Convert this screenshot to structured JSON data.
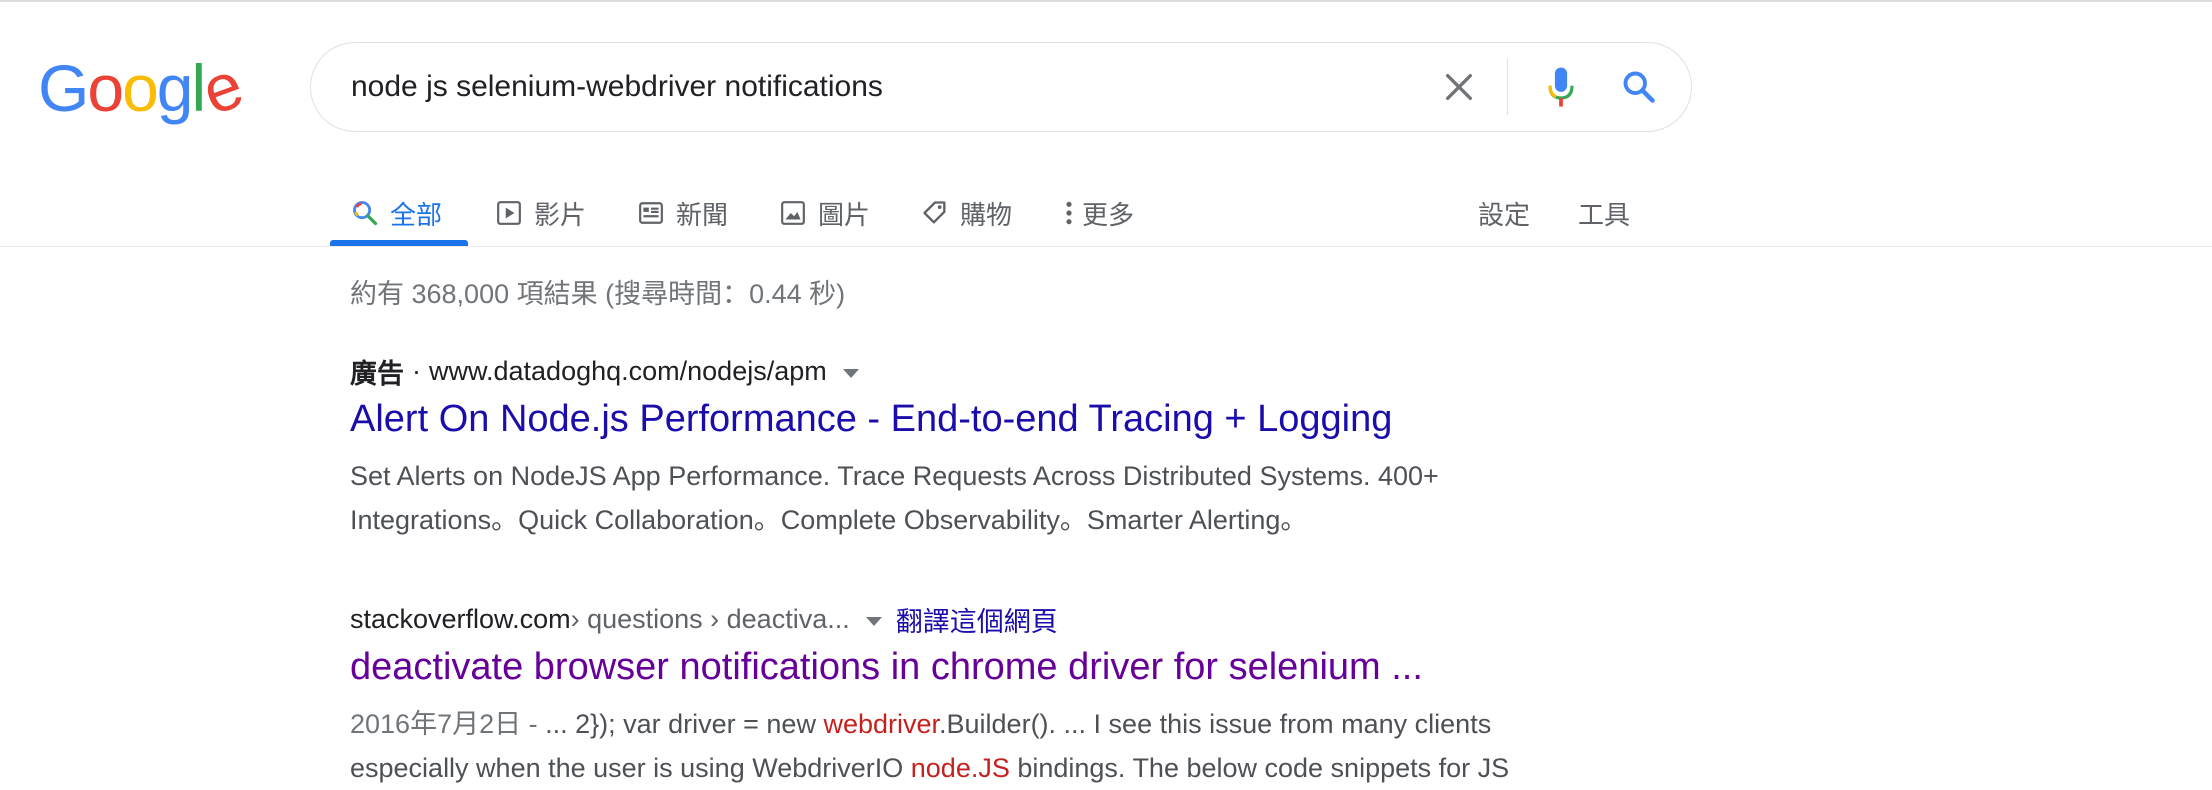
{
  "logo": {
    "letters": [
      "G",
      "o",
      "o",
      "g",
      "l",
      "e"
    ],
    "colors": [
      "#4285F4",
      "#EA4335",
      "#FBBC05",
      "#4285F4",
      "#34A853",
      "#EA4335"
    ]
  },
  "search": {
    "query": "node js selenium-webdriver notifications"
  },
  "tabs": [
    {
      "label": "全部",
      "icon": "search-icon",
      "active": true
    },
    {
      "label": "影片",
      "icon": "play-icon"
    },
    {
      "label": "新聞",
      "icon": "news-icon"
    },
    {
      "label": "圖片",
      "icon": "image-icon"
    },
    {
      "label": "購物",
      "icon": "tag-icon"
    },
    {
      "label": "更多",
      "icon": "more-vert-icon"
    }
  ],
  "tools": {
    "settings": "設定",
    "tools": "工具"
  },
  "stats": "約有 368,000 項結果 (搜尋時間：0.44 秒)",
  "results": {
    "ad": {
      "label": "廣告",
      "separator": "·",
      "url": "www.datadoghq.com/nodejs/apm",
      "title": "Alert On Node.js Performance - End-to-end Tracing + Logging",
      "snippet_line1": "Set Alerts on NodeJS App Performance. Trace Requests Across Distributed Systems. 400+",
      "snippet_line2": "Integrations。Quick Collaboration。Complete Observability。Smarter Alerting。"
    },
    "organic": {
      "domain": "stackoverflow.com",
      "path": " › questions › deactiva...",
      "translate": "翻譯這個網頁",
      "title": "deactivate browser notifications in chrome driver for selenium ...",
      "date": "2016年7月2日 - ",
      "snippet_a": "... 2}); var driver = new ",
      "snippet_em1": "webdriver",
      "snippet_b": ".Builder(). ... I see this issue from many clients",
      "snippet_c": "especially when the user is using WebdriverIO ",
      "snippet_em2": "node.JS",
      "snippet_d": " bindings. The below code snippets for JS"
    }
  },
  "colors": {
    "link": "#1a0dab",
    "visited": "#660099",
    "accent": "#1a73e8",
    "emphasis": "#c5221f"
  }
}
